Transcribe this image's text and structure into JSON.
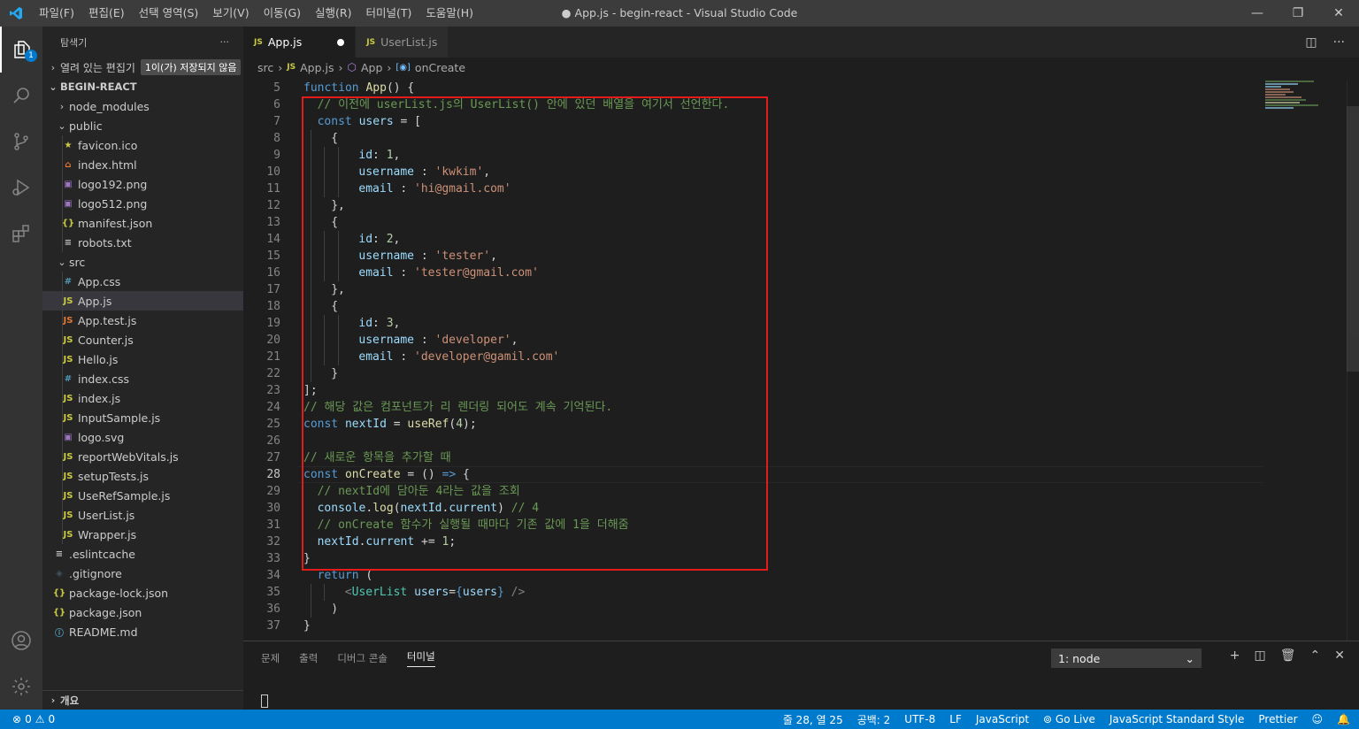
{
  "window": {
    "title": "● App.js - begin-react - Visual Studio Code",
    "menu": [
      "파일(F)",
      "편집(E)",
      "선택 영역(S)",
      "보기(V)",
      "이동(G)",
      "실행(R)",
      "터미널(T)",
      "도움말(H)"
    ],
    "controls": {
      "minimize": "—",
      "restore": "❐",
      "close": "✕"
    }
  },
  "activity_bar": {
    "explorer_badge": "1"
  },
  "sidebar": {
    "title": "탐색기",
    "more": "···",
    "open_editors_label": "열려 있는 편집기",
    "unsaved_badge": "1이(가) 저장되지 않음",
    "project_name": "BEGIN-REACT",
    "items": [
      {
        "label": "node_modules",
        "type": "folder",
        "state": "closed",
        "depth": 1
      },
      {
        "label": "public",
        "type": "folder",
        "state": "open",
        "depth": 1
      },
      {
        "label": "favicon.ico",
        "type": "file",
        "icon": "★",
        "icon_color": "#cbcb41",
        "depth": 2
      },
      {
        "label": "index.html",
        "type": "file",
        "icon": "⌂",
        "icon_color": "#e37933",
        "depth": 2
      },
      {
        "label": "logo192.png",
        "type": "file",
        "icon": "▣",
        "icon_color": "#a074c4",
        "depth": 2
      },
      {
        "label": "logo512.png",
        "type": "file",
        "icon": "▣",
        "icon_color": "#a074c4",
        "depth": 2
      },
      {
        "label": "manifest.json",
        "type": "file",
        "icon": "{}",
        "icon_color": "#cbcb41",
        "depth": 2
      },
      {
        "label": "robots.txt",
        "type": "file",
        "icon": "≡",
        "icon_color": "#c5c5c5",
        "depth": 2
      },
      {
        "label": "src",
        "type": "folder",
        "state": "open",
        "depth": 1
      },
      {
        "label": "App.css",
        "type": "file",
        "icon": "#",
        "icon_color": "#519aba",
        "depth": 2
      },
      {
        "label": "App.js",
        "type": "file",
        "icon": "JS",
        "icon_color": "#cbcb41",
        "depth": 2,
        "selected": true
      },
      {
        "label": "App.test.js",
        "type": "file",
        "icon": "JS",
        "icon_color": "#e37933",
        "depth": 2
      },
      {
        "label": "Counter.js",
        "type": "file",
        "icon": "JS",
        "icon_color": "#cbcb41",
        "depth": 2
      },
      {
        "label": "Hello.js",
        "type": "file",
        "icon": "JS",
        "icon_color": "#cbcb41",
        "depth": 2
      },
      {
        "label": "index.css",
        "type": "file",
        "icon": "#",
        "icon_color": "#519aba",
        "depth": 2
      },
      {
        "label": "index.js",
        "type": "file",
        "icon": "JS",
        "icon_color": "#cbcb41",
        "depth": 2
      },
      {
        "label": "InputSample.js",
        "type": "file",
        "icon": "JS",
        "icon_color": "#cbcb41",
        "depth": 2
      },
      {
        "label": "logo.svg",
        "type": "file",
        "icon": "▣",
        "icon_color": "#a074c4",
        "depth": 2
      },
      {
        "label": "reportWebVitals.js",
        "type": "file",
        "icon": "JS",
        "icon_color": "#cbcb41",
        "depth": 2
      },
      {
        "label": "setupTests.js",
        "type": "file",
        "icon": "JS",
        "icon_color": "#cbcb41",
        "depth": 2
      },
      {
        "label": "UseRefSample.js",
        "type": "file",
        "icon": "JS",
        "icon_color": "#cbcb41",
        "depth": 2
      },
      {
        "label": "UserList.js",
        "type": "file",
        "icon": "JS",
        "icon_color": "#cbcb41",
        "depth": 2
      },
      {
        "label": "Wrapper.js",
        "type": "file",
        "icon": "JS",
        "icon_color": "#cbcb41",
        "depth": 2
      },
      {
        "label": ".eslintcache",
        "type": "file",
        "icon": "≡",
        "icon_color": "#c5c5c5",
        "depth": 1
      },
      {
        "label": ".gitignore",
        "type": "file",
        "icon": "◈",
        "icon_color": "#41535b",
        "depth": 1
      },
      {
        "label": "package-lock.json",
        "type": "file",
        "icon": "{}",
        "icon_color": "#cbcb41",
        "depth": 1
      },
      {
        "label": "package.json",
        "type": "file",
        "icon": "{}",
        "icon_color": "#cbcb41",
        "depth": 1
      },
      {
        "label": "README.md",
        "type": "file",
        "icon": "ⓘ",
        "icon_color": "#519aba",
        "depth": 1
      }
    ],
    "outline_label": "개요"
  },
  "tabs": [
    {
      "label": "App.js",
      "active": true,
      "dirty": true
    },
    {
      "label": "UserList.js",
      "active": false,
      "dirty": false
    }
  ],
  "breadcrumb": {
    "folder": "src",
    "file": "App.js",
    "component": "App",
    "symbol": "onCreate"
  },
  "editor": {
    "cursor_line": 28,
    "lines": [
      {
        "n": 5,
        "indent": 0,
        "tokens": [
          [
            "kw",
            "function "
          ],
          [
            "fn",
            "App"
          ],
          [
            "pun",
            "() {"
          ]
        ]
      },
      {
        "n": 6,
        "indent": 1,
        "tokens": [
          [
            "com",
            "// 이전에 userList.js의 UserList() 안에 있던 배열을 여기서 선언한다."
          ]
        ]
      },
      {
        "n": 7,
        "indent": 1,
        "tokens": [
          [
            "kw",
            "const "
          ],
          [
            "var",
            "users"
          ],
          [
            "pun",
            " = ["
          ]
        ]
      },
      {
        "n": 8,
        "indent": 2,
        "tokens": [
          [
            "pun",
            "{"
          ]
        ]
      },
      {
        "n": 9,
        "indent": 4,
        "tokens": [
          [
            "var",
            "id"
          ],
          [
            "pun",
            ": "
          ],
          [
            "num",
            "1"
          ],
          [
            "pun",
            ","
          ]
        ]
      },
      {
        "n": 10,
        "indent": 4,
        "tokens": [
          [
            "var",
            "username"
          ],
          [
            "pun",
            " : "
          ],
          [
            "str",
            "'kwkim'"
          ],
          [
            "pun",
            ","
          ]
        ]
      },
      {
        "n": 11,
        "indent": 4,
        "tokens": [
          [
            "var",
            "email"
          ],
          [
            "pun",
            " : "
          ],
          [
            "str",
            "'hi@gmail.com'"
          ]
        ]
      },
      {
        "n": 12,
        "indent": 2,
        "tokens": [
          [
            "pun",
            "},"
          ]
        ]
      },
      {
        "n": 13,
        "indent": 2,
        "tokens": [
          [
            "pun",
            "{"
          ]
        ]
      },
      {
        "n": 14,
        "indent": 4,
        "tokens": [
          [
            "var",
            "id"
          ],
          [
            "pun",
            ": "
          ],
          [
            "num",
            "2"
          ],
          [
            "pun",
            ","
          ]
        ]
      },
      {
        "n": 15,
        "indent": 4,
        "tokens": [
          [
            "var",
            "username"
          ],
          [
            "pun",
            " : "
          ],
          [
            "str",
            "'tester'"
          ],
          [
            "pun",
            ","
          ]
        ]
      },
      {
        "n": 16,
        "indent": 4,
        "tokens": [
          [
            "var",
            "email"
          ],
          [
            "pun",
            " : "
          ],
          [
            "str",
            "'tester@gmail.com'"
          ]
        ]
      },
      {
        "n": 17,
        "indent": 2,
        "tokens": [
          [
            "pun",
            "},"
          ]
        ]
      },
      {
        "n": 18,
        "indent": 2,
        "tokens": [
          [
            "pun",
            "{"
          ]
        ]
      },
      {
        "n": 19,
        "indent": 4,
        "tokens": [
          [
            "var",
            "id"
          ],
          [
            "pun",
            ": "
          ],
          [
            "num",
            "3"
          ],
          [
            "pun",
            ","
          ]
        ]
      },
      {
        "n": 20,
        "indent": 4,
        "tokens": [
          [
            "var",
            "username"
          ],
          [
            "pun",
            " : "
          ],
          [
            "str",
            "'developer'"
          ],
          [
            "pun",
            ","
          ]
        ]
      },
      {
        "n": 21,
        "indent": 4,
        "tokens": [
          [
            "var",
            "email"
          ],
          [
            "pun",
            " : "
          ],
          [
            "str",
            "'developer@gamil.com'"
          ]
        ]
      },
      {
        "n": 22,
        "indent": 2,
        "tokens": [
          [
            "pun",
            "}"
          ]
        ]
      },
      {
        "n": 23,
        "indent": 0,
        "tokens": [
          [
            "pun",
            "];"
          ]
        ]
      },
      {
        "n": 24,
        "indent": 0,
        "tokens": [
          [
            "com",
            "// 해당 값은 컴포넌트가 리 렌더링 되어도 계속 기억된다."
          ]
        ]
      },
      {
        "n": 25,
        "indent": 0,
        "tokens": [
          [
            "kw",
            "const "
          ],
          [
            "var",
            "nextId"
          ],
          [
            "pun",
            " = "
          ],
          [
            "fn",
            "useRef"
          ],
          [
            "pun",
            "("
          ],
          [
            "num",
            "4"
          ],
          [
            "pun",
            ");"
          ]
        ]
      },
      {
        "n": 26,
        "indent": 0,
        "tokens": []
      },
      {
        "n": 27,
        "indent": 0,
        "tokens": [
          [
            "com",
            "// 새로운 항목을 추가할 때"
          ]
        ]
      },
      {
        "n": 28,
        "indent": 0,
        "tokens": [
          [
            "kw",
            "const "
          ],
          [
            "fn",
            "onCreate"
          ],
          [
            "pun",
            " = () "
          ],
          [
            "kw",
            "=>"
          ],
          [
            "pun",
            " {"
          ]
        ]
      },
      {
        "n": 29,
        "indent": 1,
        "tokens": [
          [
            "com",
            "// nextId에 담아둔 4라는 값을 조회"
          ]
        ]
      },
      {
        "n": 30,
        "indent": 1,
        "tokens": [
          [
            "var",
            "console"
          ],
          [
            "pun",
            "."
          ],
          [
            "fn",
            "log"
          ],
          [
            "pun",
            "("
          ],
          [
            "var",
            "nextId"
          ],
          [
            "pun",
            "."
          ],
          [
            "var",
            "current"
          ],
          [
            "pun",
            ") "
          ],
          [
            "com",
            "// 4"
          ]
        ]
      },
      {
        "n": 31,
        "indent": 1,
        "tokens": [
          [
            "com",
            "// onCreate 함수가 실행될 때마다 기존 값에 1을 더해줌"
          ]
        ]
      },
      {
        "n": 32,
        "indent": 1,
        "tokens": [
          [
            "var",
            "nextId"
          ],
          [
            "pun",
            "."
          ],
          [
            "var",
            "current"
          ],
          [
            "pun",
            " += "
          ],
          [
            "num",
            "1"
          ],
          [
            "pun",
            ";"
          ]
        ]
      },
      {
        "n": 33,
        "indent": 0,
        "tokens": [
          [
            "pun",
            "}"
          ]
        ]
      },
      {
        "n": 34,
        "indent": 1,
        "tokens": [
          [
            "kw",
            "return"
          ],
          [
            "pun",
            " ("
          ]
        ]
      },
      {
        "n": 35,
        "indent": 3,
        "tokens": [
          [
            "tagp",
            "<"
          ],
          [
            "tag",
            "UserList"
          ],
          [
            "var",
            " users"
          ],
          [
            "pun",
            "="
          ],
          [
            "kw",
            "{"
          ],
          [
            "var",
            "users"
          ],
          [
            "kw",
            "}"
          ],
          [
            "tagp",
            " />"
          ]
        ]
      },
      {
        "n": 36,
        "indent": 2,
        "tokens": [
          [
            "pun",
            ")"
          ]
        ]
      },
      {
        "n": 37,
        "indent": 0,
        "tokens": [
          [
            "pun",
            "}"
          ]
        ]
      }
    ]
  },
  "panel": {
    "tabs": [
      "문제",
      "출력",
      "디버그 콘솔",
      "터미널"
    ],
    "active_tab": "터미널",
    "terminal_select": "1: node"
  },
  "status": {
    "errors": "0",
    "warnings": "0",
    "position": "줄 28, 열 25",
    "spaces": "공백: 2",
    "encoding": "UTF-8",
    "eol": "LF",
    "language": "JavaScript",
    "go_live": "Go Live",
    "style": "JavaScript Standard Style",
    "formatter": "Prettier"
  },
  "colors": {
    "accent": "#007acc",
    "highlight_box": "#e51a1a"
  }
}
